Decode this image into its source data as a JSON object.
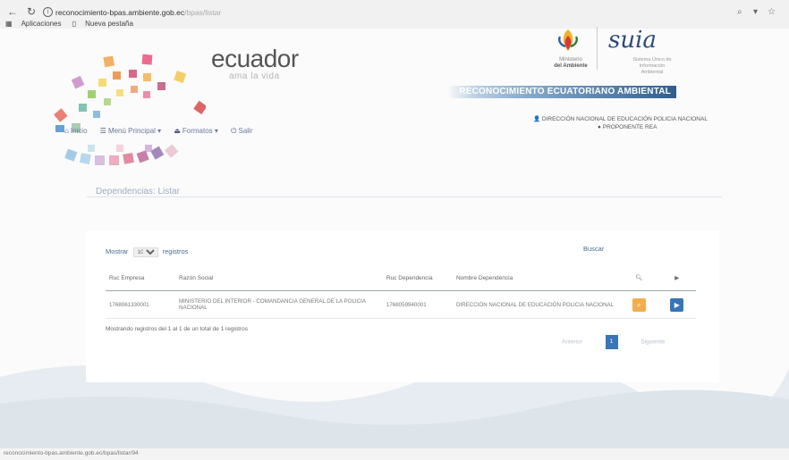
{
  "browser": {
    "url_host": "reconocimiento-bpas.ambiente.gob.ec",
    "url_path": "/bpas/listar",
    "bookmarks": [
      "Aplicaciones",
      "Nueva pestaña"
    ]
  },
  "header": {
    "logo_title": "ecuador",
    "logo_tagline": "ama la vida",
    "ministerio_top": "Ministerio",
    "ministerio_bottom": "del Ambiente",
    "suia_logo": "suia",
    "suia_sub1": "Sistema Único de",
    "suia_sub2": "Información Ambiental",
    "banner": "RECONOCIMIENTO ECUATORIANO AMBIENTAL",
    "user": "DIRECCIÓN NACIONAL DE EDUCACIÓN POLICIA NACIONAL",
    "role": "PROPONENTE REA"
  },
  "nav": {
    "items": [
      {
        "label": "Inicio"
      },
      {
        "label": "Menú Principal ▾"
      },
      {
        "label": "Formatos ▾"
      },
      {
        "label": "Salir"
      }
    ]
  },
  "breadcrumb": "Dependencias: Listar",
  "table": {
    "show_label": "Mostrar",
    "show_value": "10",
    "show_suffix": "registros",
    "search_label": "Buscar",
    "columns": [
      "Ruc Empresa",
      "Razón Social",
      "Ruc Dependencia",
      "Nombre Dependencia"
    ],
    "rows": [
      {
        "ruc_empresa": "1768061330001",
        "razon_social": "MINISTERIO DEL INTERIOR - COMANDANCIA GENERAL DE LA POLICIA NACIONAL",
        "ruc_dependencia": "1768059940001",
        "nombre_dependencia": "DIRECCIÓN NACIONAL DE EDUCACIÓN POLICIA NACIONAL"
      }
    ],
    "info": "Mostrando registros del 1 al 1 de un total de 1 registros",
    "pagination": {
      "prev": "Anterior",
      "current": "1",
      "next": "Siguiente"
    }
  },
  "status_bar": "reconocimiento-bpas.ambiente.gob.ec/bpas/listar/94",
  "colors": {
    "accent": "#3675b7",
    "warning": "#f1ad4e",
    "banner": "#2f5e8d"
  }
}
